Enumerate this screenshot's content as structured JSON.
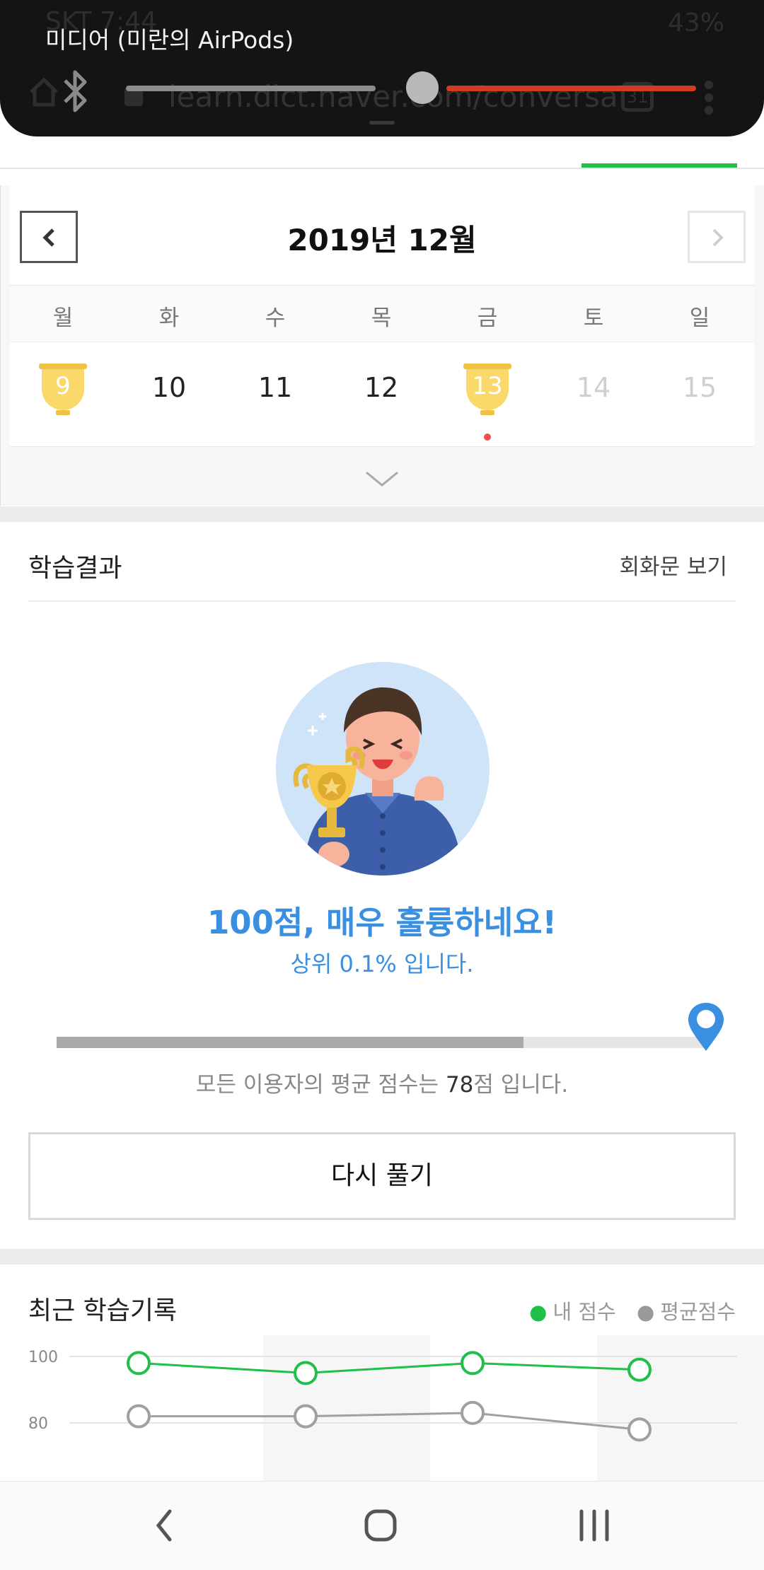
{
  "overlay": {
    "title": "미디어 (미란의 AirPods)",
    "status_time": "SKT 7:44",
    "status_battery": "43%",
    "url_ghost": "learn.dict.naver.com/conversa",
    "tab_count": "31",
    "volume_level": 0.55,
    "slider_colors": {
      "left": "#8c8c8c",
      "right": "#d23a22"
    }
  },
  "calendar": {
    "month_title": "2019년 12월",
    "weekdays": [
      "월",
      "화",
      "수",
      "목",
      "금",
      "토",
      "일"
    ],
    "days": [
      {
        "label": "9",
        "trophy": true,
        "dot": false,
        "dim": false
      },
      {
        "label": "10",
        "trophy": false,
        "dot": false,
        "dim": false
      },
      {
        "label": "11",
        "trophy": false,
        "dot": false,
        "dim": false
      },
      {
        "label": "12",
        "trophy": false,
        "dot": false,
        "dim": false
      },
      {
        "label": "13",
        "trophy": true,
        "dot": true,
        "dim": false
      },
      {
        "label": "14",
        "trophy": false,
        "dot": false,
        "dim": true
      },
      {
        "label": "15",
        "trophy": false,
        "dot": false,
        "dim": true
      }
    ]
  },
  "result": {
    "title": "학습결과",
    "view_conversation": "회화문 보기",
    "score_message": "100점, 매우 훌륭하네요!",
    "rank_message": "상위 0.1% 입니다.",
    "my_score": 100,
    "average_score": 78,
    "average_prefix": "모든 이용자의 평균 점수는 ",
    "average_value": "78",
    "average_suffix": "점 입니다.",
    "retry_label": "다시 풀기"
  },
  "history": {
    "title": "최근 학습기록",
    "legend_mine": "내 점수",
    "legend_avg": "평균점수"
  },
  "chart_data": {
    "type": "line",
    "title": "최근 학습기록",
    "y_ticks": [
      "100",
      "80"
    ],
    "ylim": [
      70,
      100
    ],
    "x": [
      1,
      2,
      3,
      4
    ],
    "series": [
      {
        "name": "내 점수",
        "color": "#1fbf4a",
        "values": [
          98,
          95,
          98,
          96
        ]
      },
      {
        "name": "평균점수",
        "color": "#a0a0a0",
        "values": [
          82,
          82,
          83,
          78
        ]
      }
    ],
    "shaded_columns": [
      2,
      4
    ],
    "grid": true,
    "legend_position": "top-right"
  }
}
